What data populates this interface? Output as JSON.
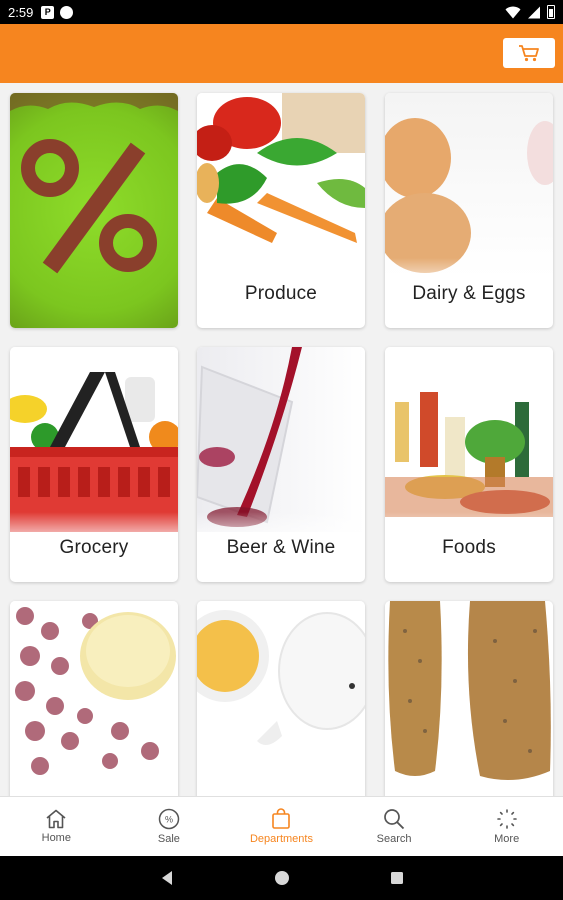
{
  "status_bar": {
    "time": "2:59",
    "notification_icon_letter": "P"
  },
  "app_bar": {
    "background_color": "#f6851f",
    "cart_icon": "cart-icon"
  },
  "departments": [
    {
      "label": ""
    },
    {
      "label": "Produce"
    },
    {
      "label": "Dairy & Eggs"
    },
    {
      "label": "Grocery"
    },
    {
      "label": "Beer & Wine"
    },
    {
      "label": "Foods"
    },
    {
      "label": ""
    },
    {
      "label": ""
    },
    {
      "label": ""
    }
  ],
  "bottom_nav": {
    "items": [
      {
        "label": "Home",
        "icon": "home-icon"
      },
      {
        "label": "Sale",
        "icon": "sale-icon"
      },
      {
        "label": "Departments",
        "icon": "bag-icon"
      },
      {
        "label": "Search",
        "icon": "search-icon"
      },
      {
        "label": "More",
        "icon": "more-icon"
      }
    ],
    "active_index": 2,
    "accent_color": "#f6851f"
  }
}
